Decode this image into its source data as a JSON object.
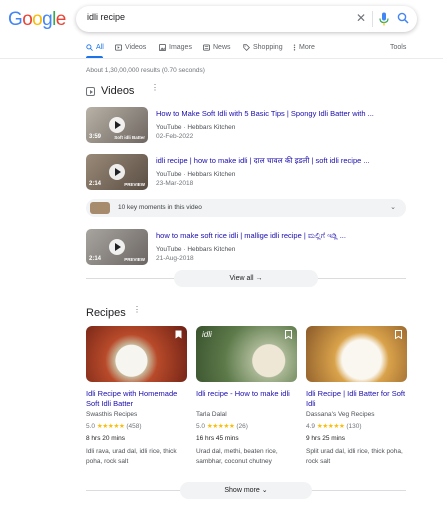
{
  "logo": {
    "letters": [
      "G",
      "o",
      "o",
      "g",
      "l",
      "e"
    ],
    "colors": [
      "#4285f4",
      "#ea4335",
      "#fbbc05",
      "#4285f4",
      "#34a853",
      "#ea4335"
    ]
  },
  "search": {
    "query": "idli recipe"
  },
  "tabs": [
    {
      "label": "All",
      "icon": "search-icon",
      "active": true
    },
    {
      "label": "Videos",
      "icon": "video-icon"
    },
    {
      "label": "Images",
      "icon": "image-icon"
    },
    {
      "label": "News",
      "icon": "news-icon"
    },
    {
      "label": "Shopping",
      "icon": "tag-icon"
    },
    {
      "label": "More",
      "icon": "more-vert-icon"
    }
  ],
  "tools_label": "Tools",
  "result_stats": "About 1,30,00,000 results (0.70 seconds)",
  "videos": {
    "heading": "Videos",
    "items": [
      {
        "title": "How to Make Soft Idli with 5 Basic Tips | Spongy Idli Batter with ...",
        "source": "YouTube · Hebbars Kitchen",
        "date": "02-Feb-2022",
        "duration": "3:59",
        "overlay": "Soft idli Batter"
      },
      {
        "title": "idli recipe | how to make idli | दाल चावल की इडली | soft idli recipe ...",
        "source": "YouTube · Hebbars Kitchen",
        "date": "23-Mar-2018",
        "duration": "2:14",
        "overlay": "PREVIEW"
      },
      {
        "title": "how to make soft rice idli | mallige idli recipe | ಮಲ್ಲಿಗೆ ಇಡ್ಲಿ ...",
        "source": "YouTube · Hebbars Kitchen",
        "date": "21-Aug-2018",
        "duration": "2:14",
        "overlay": "PREVIEW"
      }
    ],
    "key_moments": "10 key moments in this video",
    "view_all": "View all"
  },
  "recipes": {
    "heading": "Recipes",
    "items": [
      {
        "title": "Idli Recipe with Homemade Soft Idli Batter",
        "source": "Swasthis Recipes",
        "rating": "5.0",
        "stars": "★★★★★",
        "count": "(458)",
        "time": "8 hrs 20 mins",
        "ingredients": "Idli rava, urad dal, idli rice, thick poha, rock salt"
      },
      {
        "title": "Idli recipe - How to make idli",
        "source": "Tarla Dalal",
        "rating": "5.0",
        "stars": "★★★★★",
        "count": "(26)",
        "time": "16 hrs 45 mins",
        "ingredients": "Urad dal, methi, beaten rice, sambhar, coconut chutney"
      },
      {
        "title": "Idli Recipe | Idli Batter for Soft Idli",
        "source": "Dassana's Veg Recipes",
        "rating": "4.9",
        "stars": "★★★★★",
        "count": "(130)",
        "time": "9 hrs 25 mins",
        "ingredients": "Split urad dal, idli rice, thick poha, rock salt"
      }
    ],
    "image_labels": [
      "",
      "idli",
      ""
    ],
    "show_more": "Show more"
  }
}
